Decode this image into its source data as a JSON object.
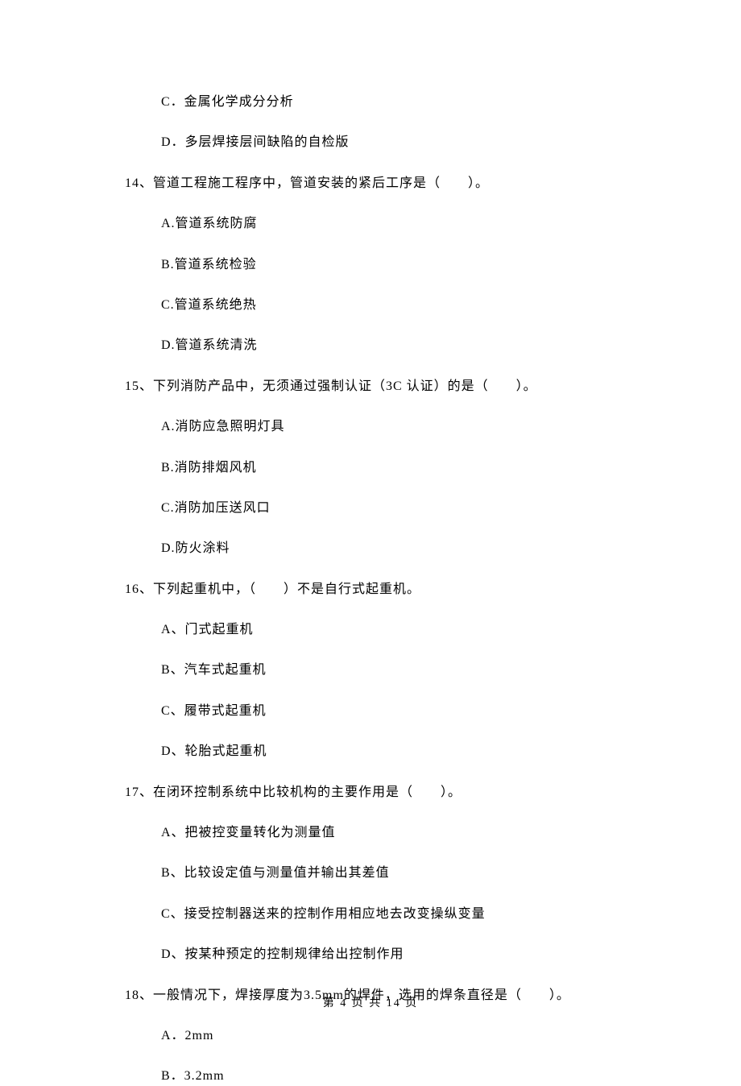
{
  "orphan_options": {
    "c": "C．金属化学成分分析",
    "d": "D．多层焊接层间缺陷的自检版"
  },
  "q14": {
    "text": "14、管道工程施工程序中，管道安装的紧后工序是（　　）。",
    "a": "A.管道系统防腐",
    "b": "B.管道系统检验",
    "c": "C.管道系统绝热",
    "d": "D.管道系统清洗"
  },
  "q15": {
    "text": "15、下列消防产品中，无须通过强制认证（3C 认证）的是（　　）。",
    "a": "A.消防应急照明灯具",
    "b": "B.消防排烟风机",
    "c": "C.消防加压送风口",
    "d": "D.防火涂料"
  },
  "q16": {
    "text": "16、下列起重机中，（　　）不是自行式起重机。",
    "a": "A、门式起重机",
    "b": "B、汽车式起重机",
    "c": "C、履带式起重机",
    "d": "D、轮胎式起重机"
  },
  "q17": {
    "text": "17、在闭环控制系统中比较机构的主要作用是（　　）。",
    "a": "A、把被控变量转化为测量值",
    "b": "B、比较设定值与测量值并输出其差值",
    "c": "C、接受控制器送来的控制作用相应地去改变操纵变量",
    "d": "D、按某种预定的控制规律给出控制作用"
  },
  "q18": {
    "text": "18、一般情况下，焊接厚度为3.5mm的焊件，选用的焊条直径是（　　）。",
    "a": "A．2mm",
    "b": "B．3.2mm"
  },
  "footer": "第 4 页 共 14 页"
}
